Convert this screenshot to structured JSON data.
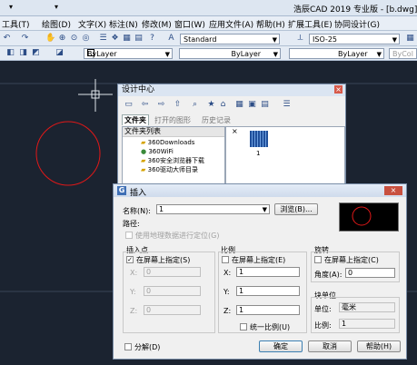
{
  "window": {
    "title": "浩辰CAD 2019 专业版 - [b.dwg]",
    "qat_left": "▾",
    "qat_right": "▾"
  },
  "menu": {
    "items": [
      "工具(T)",
      "绘图(D)",
      "文字(X)",
      "标注(N)",
      "修改(M)",
      "窗口(W)",
      "应用文件(A)",
      "帮助(H)",
      "扩展工具(E)",
      "协同设计(G)"
    ]
  },
  "toolbar": {
    "text_style": "Standard",
    "dim_style": "ISO-25",
    "color": "ByLayer",
    "linetype": "ByLayer",
    "lineweight": "ByLayer",
    "plot_style": "ByCol"
  },
  "design_center": {
    "title": "设计中心",
    "tabs": [
      "文件夹",
      "打开的图形",
      "历史记录"
    ],
    "list_header": "文件夹列表",
    "folders": [
      "360Downloads",
      "360WiFi",
      "360安全浏览器下载",
      "360驱动大师目录"
    ],
    "preview_caption": "1",
    "close_glyph": "×"
  },
  "insert": {
    "title": "插入",
    "name_label": "名称(N):",
    "name_value": "1",
    "browse_label": "浏览(B)...",
    "path_label": "路径:",
    "geo_label": "使用地理数据进行定位(G)",
    "insert_point": {
      "title": "插入点",
      "on_screen": "在屏幕上指定(S)",
      "x_label": "X:",
      "x": "0",
      "y_label": "Y:",
      "y": "0",
      "z_label": "Z:",
      "z": "0"
    },
    "scale": {
      "title": "比例",
      "on_screen": "在屏幕上指定(E)",
      "x_label": "X:",
      "x": "1",
      "y_label": "Y:",
      "y": "1",
      "z_label": "Z:",
      "z": "1",
      "uniform": "统一比例(U)"
    },
    "rotation": {
      "title": "旋转",
      "on_screen": "在屏幕上指定(C)",
      "angle_label": "角度(A):",
      "angle": "0"
    },
    "block_unit": {
      "title": "块单位",
      "unit_label": "单位:",
      "unit": "毫米",
      "factor_label": "比例:",
      "factor": "1"
    },
    "explode": "分解(D)",
    "ok": "确定",
    "cancel": "取消",
    "help": "帮助(H)",
    "close_glyph": "×",
    "checkmark": "✓"
  },
  "colors": {
    "canvas": "#1b2330",
    "circle": "#e01818",
    "dialog_title_active": "#3f6fb5"
  }
}
